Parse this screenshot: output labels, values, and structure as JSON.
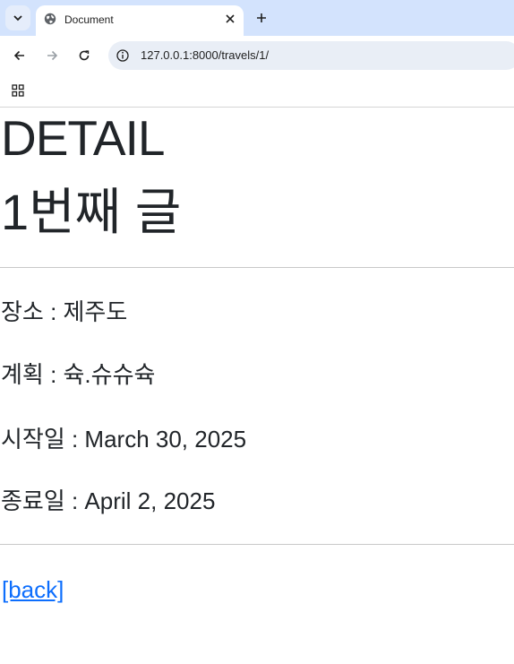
{
  "browser": {
    "tab_title": "Document",
    "url": "127.0.0.1:8000/travels/1/"
  },
  "page": {
    "heading": "DETAIL",
    "title": "1번째 글",
    "fields": [
      {
        "label": "장소",
        "value": "제주도",
        "text": "장소 : 제주도"
      },
      {
        "label": "계획",
        "value": "슉.슈슈슉",
        "text": "계획 : 슉.슈슈슉"
      },
      {
        "label": "시작일",
        "value": "March 30, 2025",
        "text": "시작일 : March 30, 2025"
      },
      {
        "label": "종료일",
        "value": "April 2, 2025",
        "text": "종료일 : April 2, 2025"
      }
    ],
    "back_link": "[back]"
  },
  "colors": {
    "tabstrip_bg": "#d3e3fd",
    "omnibox_bg": "#e9eef6",
    "link": "#0d6efd",
    "text": "#212529"
  }
}
